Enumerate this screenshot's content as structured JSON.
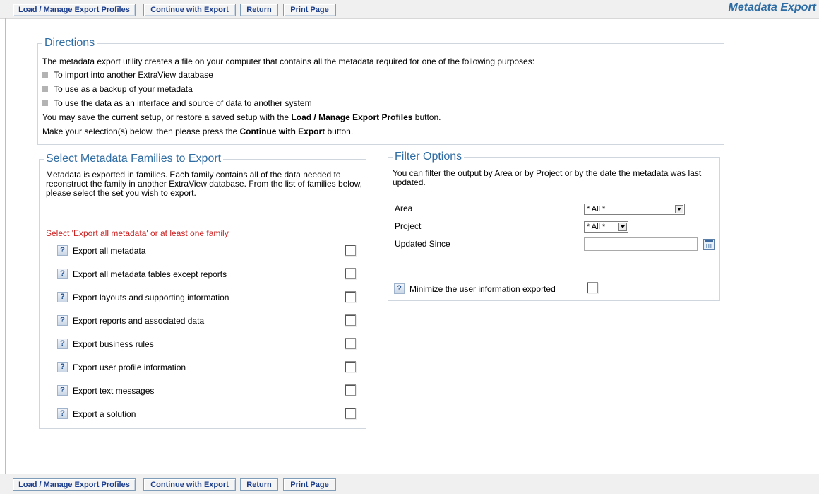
{
  "toolbar": {
    "buttons": [
      "Load / Manage Export Profiles",
      "Continue with Export",
      "Return",
      "Print Page"
    ]
  },
  "page_title": "Metadata Export",
  "directions": {
    "legend": "Directions",
    "intro": "The metadata export utility creates a file on your computer that contains all the metadata required for one of the following purposes:",
    "bullets": [
      "To import into another ExtraView database",
      "To use as a backup of your metadata",
      "To use the data as an interface and source of data to another system"
    ],
    "save_line": {
      "pre": "You may save the current setup, or restore a saved setup with the ",
      "bold": "Load / Manage Export Profiles",
      "post": " button."
    },
    "select_line": {
      "pre": "Make your selection(s) below, then please press the ",
      "bold": "Continue with Export",
      "post": " button."
    }
  },
  "families": {
    "legend": "Select Metadata Families to Export",
    "description": "Metadata is exported in families. Each family contains all of the data needed to reconstruct the family in another ExtraView database. From the list of families below, please select the set you wish to export.",
    "warning": "Select 'Export all metadata' or at least one family",
    "help_glyph": "?",
    "items": [
      {
        "label": "Export all metadata",
        "checked": false
      },
      {
        "label": "Export all metadata tables except reports",
        "checked": false
      },
      {
        "label": "Export layouts and supporting information",
        "checked": false
      },
      {
        "label": "Export reports and associated data",
        "checked": false
      },
      {
        "label": "Export business rules",
        "checked": false
      },
      {
        "label": "Export user profile information",
        "checked": false
      },
      {
        "label": "Export text messages",
        "checked": false
      },
      {
        "label": "Export a solution",
        "checked": false
      }
    ]
  },
  "filter": {
    "legend": "Filter Options",
    "description": "You can filter the output by Area or by Project or by the date the metadata was last updated.",
    "area_label": "Area",
    "area_value": "* All *",
    "project_label": "Project",
    "project_value": "* All *",
    "updated_label": "Updated Since",
    "updated_value": "",
    "minimize_label": "Minimize the user information exported",
    "minimize_checked": false
  },
  "colors": {
    "accent": "#2e6ca4",
    "button_text": "#1a3c8c",
    "warning": "#cc2222"
  }
}
